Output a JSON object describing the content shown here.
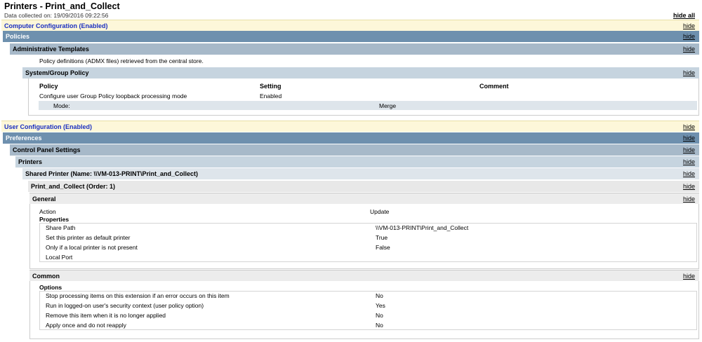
{
  "header": {
    "title": "Printers - Print_and_Collect",
    "collected": "Data collected on: 19/09/2016 09:22:56",
    "hide_all": "hide all"
  },
  "hide_label": "hide",
  "computer": {
    "title": "Computer Configuration (Enabled)",
    "policies": "Policies",
    "admin_templates": "Administrative Templates",
    "admx_note": "Policy definitions (ADMX files) retrieved from the central store.",
    "system_group_policy": "System/Group Policy",
    "table_headers": {
      "policy": "Policy",
      "setting": "Setting",
      "comment": "Comment"
    },
    "row": {
      "policy": "Configure user Group Policy loopback processing mode",
      "setting": "Enabled"
    },
    "mode": {
      "label": "Mode:",
      "value": "Merge"
    }
  },
  "user": {
    "title": "User Configuration (Enabled)",
    "preferences": "Preferences",
    "control_panel": "Control Panel Settings",
    "printers": "Printers",
    "shared_printer": "Shared Printer (Name: \\\\VM-013-PRINT\\Print_and_Collect)",
    "item": "Print_and_Collect (Order: 1)",
    "general": {
      "title": "General",
      "action_label": "Action",
      "action_value": "Update",
      "properties_title": "Properties",
      "properties": [
        {
          "label": "Share Path",
          "value": "\\\\VM-013-PRINT\\Print_and_Collect"
        },
        {
          "label": "Set this printer as default printer",
          "value": "True"
        },
        {
          "label": "Only if a local printer is not present",
          "value": "False"
        },
        {
          "label": "Local Port",
          "value": ""
        }
      ]
    },
    "common": {
      "title": "Common",
      "options_title": "Options",
      "options": [
        {
          "label": "Stop processing items on this extension if an error occurs on this item",
          "value": "No"
        },
        {
          "label": "Run in logged-on user's security context (user policy option)",
          "value": "Yes"
        },
        {
          "label": "Remove this item when it is no longer applied",
          "value": "No"
        },
        {
          "label": "Apply once and do not reapply",
          "value": "No"
        }
      ]
    }
  }
}
